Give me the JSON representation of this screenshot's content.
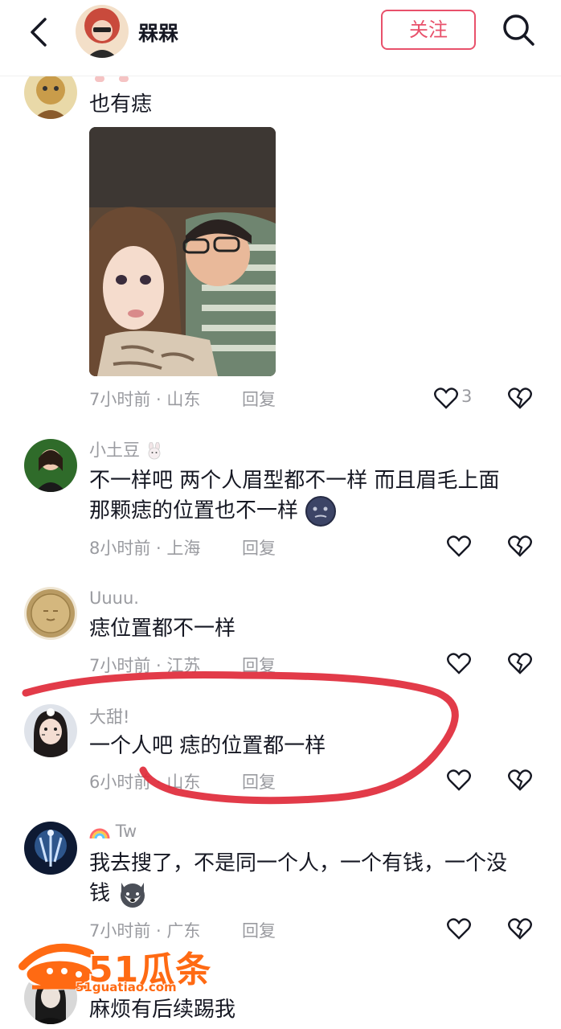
{
  "header": {
    "username": "槑槑",
    "follow_label": "关注"
  },
  "comments": [
    {
      "username": "",
      "text": "也有痣",
      "time_location": "7小时前 · 山东",
      "reply_label": "回复",
      "like_count": "3",
      "has_image": true
    },
    {
      "username": "小土豆",
      "text_line1": "不一样吧 两个人眉型都不一样 而且眉毛上面",
      "text_line2": "那颗痣的位置也不一样",
      "time_location": "8小时前 · 上海",
      "reply_label": "回复"
    },
    {
      "username": "Uuuu.",
      "text": "痣位置都不一样",
      "time_location": "7小时前 · 江苏",
      "reply_label": "回复"
    },
    {
      "username": "大甜!",
      "text": "一个人吧  痣的位置都一样",
      "time_location": "6小时前 · 山东",
      "reply_label": "回复"
    },
    {
      "username": "Tw",
      "text_line1": "我去搜了，不是同一个人，一个有钱，一个没",
      "text_line2": "钱",
      "time_location": "7小时前 · 广东",
      "reply_label": "回复"
    },
    {
      "username": "",
      "text": "麻烦有后续踢我"
    }
  ],
  "watermark": {
    "brand": "51瓜条",
    "url": "51guatiao.com"
  },
  "colors": {
    "accent": "#e8516b",
    "annotation": "#e02a3a",
    "watermark": "#ff6a13",
    "meta_text": "#9a9ba0"
  },
  "icons": [
    "back-icon",
    "search-icon",
    "heart-icon",
    "broken-heart-icon",
    "rabbit-icon",
    "moon-face-emoji",
    "rainbow-icon",
    "husky-emoji"
  ]
}
